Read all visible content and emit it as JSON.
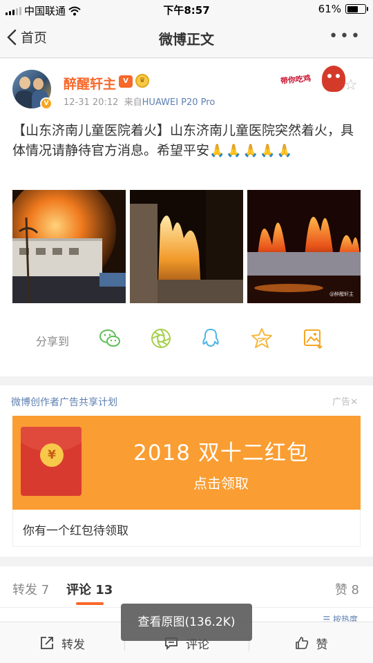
{
  "status_bar": {
    "carrier": "中国联通",
    "time": "下午8:57",
    "battery": "61%",
    "battery_level": 0.61
  },
  "nav": {
    "back_label": "首页",
    "title": "微博正文",
    "more_label": "•••"
  },
  "post": {
    "username": "醉醒轩主",
    "vip_badge": "V",
    "medal_badge": "♛",
    "date": "12-31 20:12",
    "source_prefix": "来自",
    "source": "HUAWEI P20 Pro",
    "sticker_text": "带你吃鸡",
    "text_main": "【山东济南儿童医院着火】山东济南儿童医院突然着火，具体情况请静待官方消息。希望平安",
    "text_emoji": "🙏🙏🙏🙏🙏",
    "watermark": "@醉醒轩主"
  },
  "share": {
    "label": "分享到",
    "targets": [
      "wechat-icon",
      "moments-icon",
      "qq-icon",
      "qzone-icon",
      "save-image-icon"
    ]
  },
  "ad": {
    "program": "微博创作者广告共享计划",
    "tag": "广告",
    "close": "✕",
    "headline": "2018 双十二红包",
    "cta": "点击领取",
    "coin": "¥",
    "description": "你有一个红包待领取",
    "banner_color": "#fa9d32"
  },
  "tabs": {
    "repost": "转发 7",
    "comment": "评论 13",
    "like": "赞 8"
  },
  "sort_hint": "☰ 按热度",
  "toolbar": {
    "repost": "转发",
    "comment": "评论",
    "like": "赞"
  },
  "toast": "查看原图(136.2K)",
  "colors": {
    "accent": "#f7682a",
    "link": "#5d7fb0",
    "ad_orange": "#fa9d32"
  }
}
